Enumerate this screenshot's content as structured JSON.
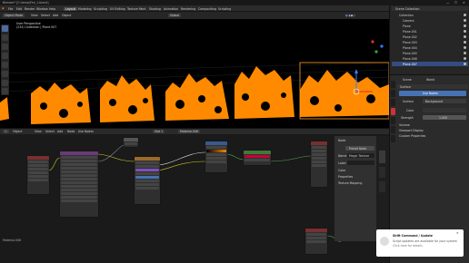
{
  "window": {
    "title": "Blender* [C:\\temp\\Fire_1.blend]",
    "controls": [
      "—",
      "☐",
      "✕"
    ]
  },
  "menus": [
    "File",
    "Edit",
    "Render",
    "Window",
    "Help"
  ],
  "workspaces": [
    "Layout",
    "Modeling",
    "Sculpting",
    "UV Editing",
    "Texture Paint",
    "Shading",
    "Animation",
    "Rendering",
    "Compositing",
    "Scripting"
  ],
  "scene": "Scene",
  "view_layer": "View Layer",
  "viewport": {
    "mode": "Object Mode",
    "menus": [
      "View",
      "Select",
      "Add",
      "Object"
    ],
    "orientation": "Global",
    "info_line1": "User Perspective",
    "info_line2": "(234) Collection | Plane.007"
  },
  "outliner": {
    "title": "Scene Collection",
    "items": [
      "Collection",
      "Camera",
      "Plane",
      "Plane.001",
      "Plane.002",
      "Plane.003",
      "Plane.004",
      "Plane.005",
      "Plane.006",
      "Plane.007"
    ],
    "selected_index": 9
  },
  "properties": {
    "tab_scene": "Scene",
    "tab_world": "World",
    "surface_section": "Surface",
    "surface_button": "Use Nodes",
    "surface_label": "Surface",
    "surface_value": "Background",
    "color_label": "Color",
    "strength_label": "Strength",
    "strength_value": "1.000",
    "volume": "Volume",
    "viewport_display": "Viewport Display",
    "custom_properties": "Custom Properties"
  },
  "node_editor": {
    "menus": [
      "View",
      "Select",
      "Add",
      "Node"
    ],
    "object": "Object",
    "material": "Material.006",
    "slot": "Slot 1",
    "use_nodes": "Use Nodes",
    "footer": "Material.006",
    "node_titles": [
      "Material Output",
      "Principled BSDF",
      "Mix Shader",
      "ColorRamp",
      "Magic Texture",
      "Emission",
      "Noise",
      "Mapping",
      "Texture Coordinate",
      "Value"
    ]
  },
  "n_panel": {
    "tab_node": "Node",
    "tab_tool": "Tool",
    "tab_view": "View",
    "section": "Node",
    "name_label": "Name",
    "name_value": "Magic Texture",
    "label_label": "Label",
    "color_label": "Color",
    "properties": "Properties",
    "texture_mapping": "Texture Mapping",
    "preset_button": "Preset Node"
  },
  "notification": {
    "title": "Shift Command / Update",
    "body": "Script updates are available for your system",
    "sub": "Click here for details",
    "close": "✕"
  },
  "colors": {
    "fire": "#ff8a00",
    "fire_dark": "#c65e00",
    "selected": "#334d80",
    "shader_header": "#3d7a3a",
    "converter_header": "#3a5a8f",
    "texture_header": "#9a6a2a",
    "output_header": "#7a2f2f",
    "input_header": "#6a3a7a"
  }
}
